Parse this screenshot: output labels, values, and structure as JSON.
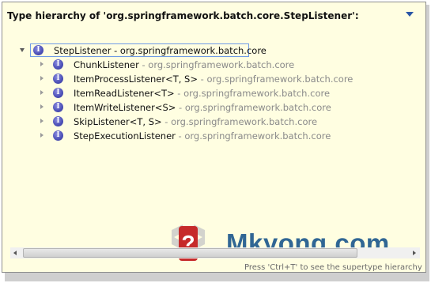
{
  "popup": {
    "title": "Type hierarchy of 'org.springframework.batch.core.StepListener':",
    "status_hint": "Press 'Ctrl+T' to see the supertype hierarchy"
  },
  "tree": {
    "root": {
      "name": "StepListener",
      "qualifier": " - org.springframework.batch.core",
      "icon": "interface-icon",
      "expanded": true,
      "selected": true
    },
    "children": [
      {
        "name": "ChunkListener",
        "qualifier": " - org.springframework.batch.core",
        "icon": "interface-icon",
        "expanded": false
      },
      {
        "name": "ItemProcessListener<T, S>",
        "qualifier": " - org.springframework.batch.core",
        "icon": "interface-icon",
        "expanded": false
      },
      {
        "name": "ItemReadListener<T>",
        "qualifier": " - org.springframework.batch.core",
        "icon": "interface-icon",
        "expanded": false
      },
      {
        "name": "ItemWriteListener<S>",
        "qualifier": " - org.springframework.batch.core",
        "icon": "interface-icon",
        "expanded": false
      },
      {
        "name": "SkipListener<T, S>",
        "qualifier": " - org.springframework.batch.core",
        "icon": "interface-icon",
        "expanded": false
      },
      {
        "name": "StepExecutionListener",
        "qualifier": " - org.springframework.batch.core",
        "icon": "interface-icon",
        "expanded": false
      }
    ]
  },
  "watermark": {
    "text": "Mkyong.com"
  },
  "colors": {
    "popup_background": "#fffee1",
    "interface_icon": "#4b4fb6",
    "selection_border": "#6f9be6",
    "watermark": "#1f5a8e"
  }
}
